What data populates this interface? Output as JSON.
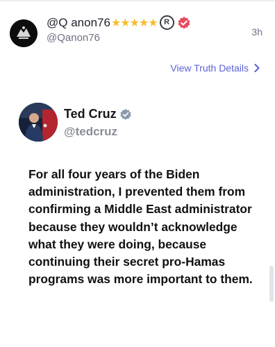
{
  "post": {
    "display_name": "@Q anon76",
    "badges": "★★★★★",
    "registered_symbol": "R",
    "handle": "@Qanon76",
    "timestamp": "3h",
    "view_details_label": "View Truth Details",
    "verified_color": "#e84a5f"
  },
  "embedded": {
    "name": "Ted Cruz",
    "handle": "@tedcruz",
    "verified_color": "#8a98ac",
    "text": "For all four years of the Biden administration, I prevented them from confirming a Middle East administrator because they wouldn’t acknowledge what they were doing, because continuing their secret pro-Hamas programs was more important to them."
  },
  "icons": [
    "avatar-symbol-icon",
    "verified-icon",
    "chevron-right-icon",
    "embedded-verified-icon"
  ]
}
